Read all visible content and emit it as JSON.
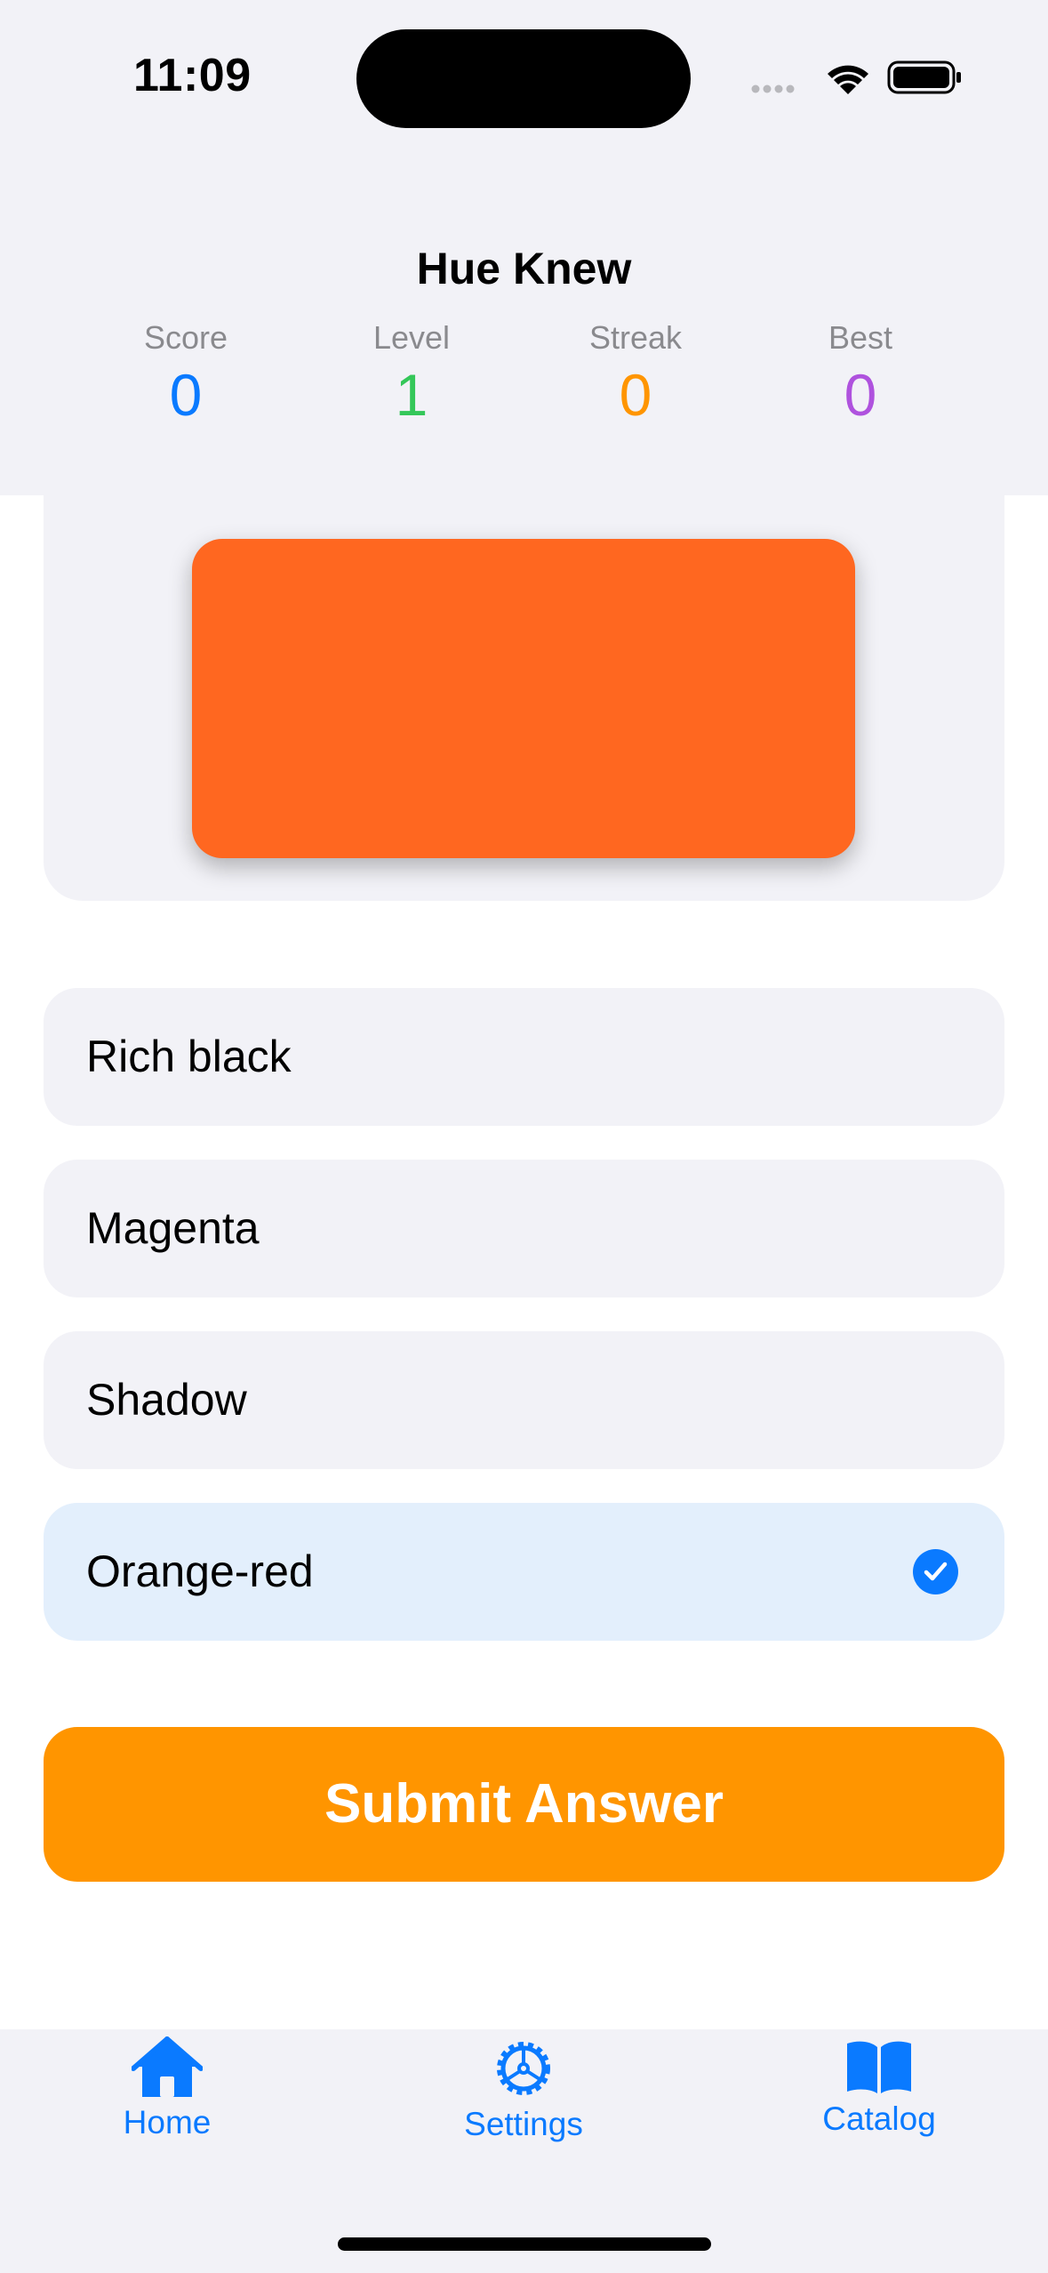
{
  "status_bar": {
    "time": "11:09"
  },
  "header": {
    "title": "Hue Knew"
  },
  "stats": [
    {
      "label": "Score",
      "value": "0",
      "color": "#0a7aff"
    },
    {
      "label": "Level",
      "value": "1",
      "color": "#34c759"
    },
    {
      "label": "Streak",
      "value": "0",
      "color": "#ff9500"
    },
    {
      "label": "Best",
      "value": "0",
      "color": "#af52de"
    }
  ],
  "swatch": {
    "color": "#ff6720"
  },
  "options": [
    {
      "label": "Rich black",
      "selected": false
    },
    {
      "label": "Magenta",
      "selected": false
    },
    {
      "label": "Shadow",
      "selected": false
    },
    {
      "label": "Orange-red",
      "selected": true
    }
  ],
  "submit": {
    "label": "Submit Answer"
  },
  "tabs": [
    {
      "label": "Home",
      "icon": "house-icon"
    },
    {
      "label": "Settings",
      "icon": "gear-icon"
    },
    {
      "label": "Catalog",
      "icon": "book-icon"
    }
  ],
  "colors": {
    "accent": "#0a7aff",
    "submit": "#ff9500",
    "selected_option": "#e3effc"
  }
}
